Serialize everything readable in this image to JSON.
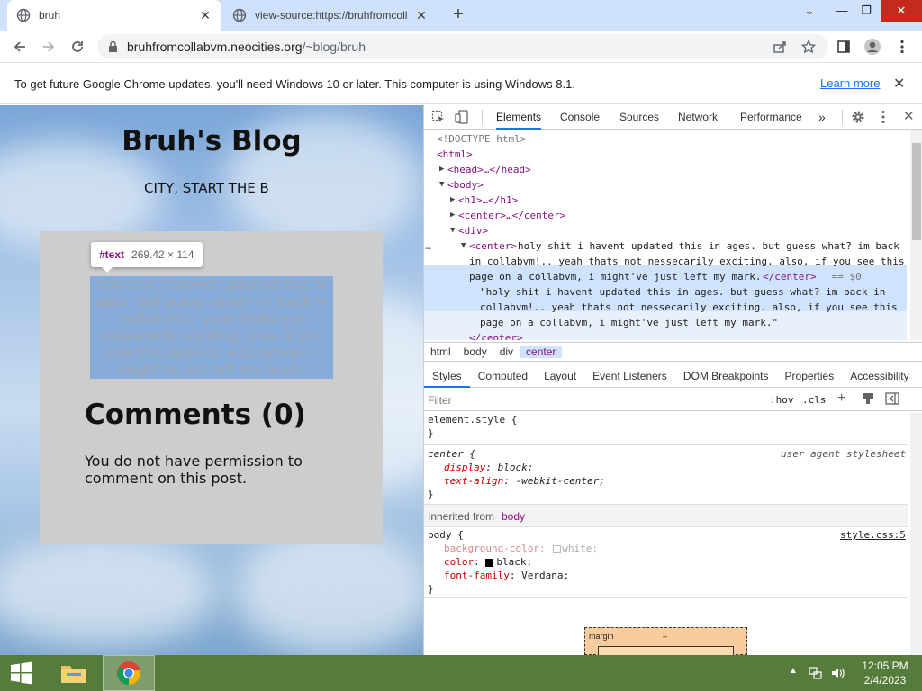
{
  "browser": {
    "tabs": [
      {
        "title": "bruh",
        "active": true
      },
      {
        "title": "view-source:https://bruhfromcoll",
        "active": false
      }
    ],
    "url_host": "bruhfromcollabvm.neocities.org",
    "url_path": "/~blog/bruh",
    "window_controls": {
      "collapse": "⌄",
      "minimize": "—",
      "restore": "❐",
      "close": "✕"
    }
  },
  "infobar": {
    "message": "To get future Google Chrome updates, you'll need Windows 10 or later. This computer is using Windows 8.1.",
    "link": "Learn more"
  },
  "page": {
    "blog_title": "Bruh's Blog",
    "marquee": "CITY, START THE B",
    "post_text": "holy shit i havent updated this in ages. but guess what? im back in collabvm!.. yeah thats not nessecarily exciting. also, if you see this page on a collabvm, i might've just left my mark.",
    "comments_heading": "Comments (0)",
    "comments_message": "You do not have permission to comment on this post.",
    "tooltip": {
      "tag": "#text",
      "dims": "269.42 × 114"
    }
  },
  "devtools": {
    "tabs": [
      "Elements",
      "Console",
      "Sources",
      "Network",
      "Performance"
    ],
    "active_tab": "Elements",
    "dom_lines": {
      "doctype": "<!DOCTYPE html>",
      "html": "<html>",
      "head": "<head>…</head>",
      "body": "<body>",
      "h1": "<h1>…</h1>",
      "center": "<center>…</center>",
      "div": "<div>",
      "center_open": "<center>",
      "center_text_1": "holy shit i havent updated this in ages. but guess what? im back",
      "center_text_2": "in collabvm!.. yeah thats not nessecarily exciting. also, if you see this",
      "center_text_3": "page on a collabvm, i might've just left my mark.",
      "center_close": "</center>",
      "selected_marker": " == $0",
      "child_text_1": "\"holy shit i havent updated this in ages. but guess what? im back in",
      "child_text_2": "collabvm!.. yeah thats not nessecarily exciting. also, if you see this",
      "child_text_3": "page on a collabvm, i might've just left my mark.\"",
      "center_end": "</center>"
    },
    "breadcrumbs": [
      "html",
      "body",
      "div",
      "center"
    ],
    "subtabs": [
      "Styles",
      "Computed",
      "Layout",
      "Event Listeners",
      "DOM Breakpoints",
      "Properties",
      "Accessibility"
    ],
    "filter_placeholder": "Filter",
    "hov": ":hov",
    "cls": ".cls",
    "styles": {
      "element_style": "element.style {",
      "close": "}",
      "center_selector": "center {",
      "ua_label": "user agent stylesheet",
      "center_props": [
        {
          "name": "display",
          "value": "block;"
        },
        {
          "name": "text-align",
          "value": "-webkit-center;"
        }
      ],
      "inherited_label": "Inherited from",
      "inherited_from": "body",
      "body_selector": "body {",
      "body_source": "style.css:5",
      "body_props": [
        {
          "name": "background-color",
          "value": "white;"
        },
        {
          "name": "color",
          "value": "black;"
        },
        {
          "name": "font-family",
          "value": "Verdana;"
        }
      ]
    },
    "box_model": {
      "label": "margin",
      "value": "–"
    }
  },
  "taskbar": {
    "time": "12:05 PM",
    "date": "2/4/2023"
  }
}
